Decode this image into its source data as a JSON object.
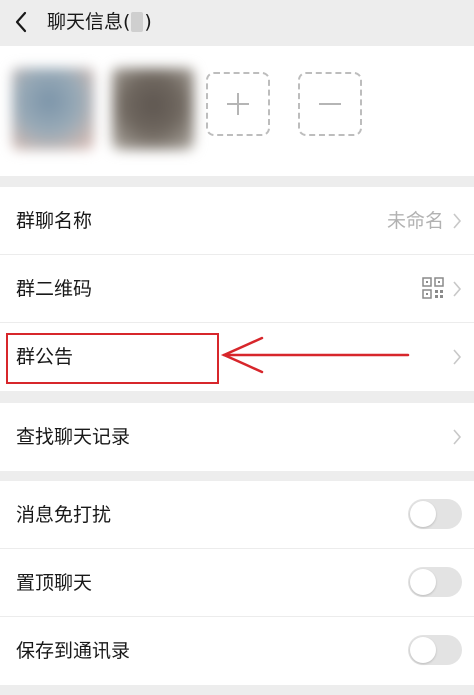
{
  "header": {
    "back_icon": "chevron-left-icon",
    "title": "聊天信息(",
    "title_suffix": ")"
  },
  "members": {
    "add_icon": "plus-icon",
    "remove_icon": "minus-icon"
  },
  "settings": {
    "group_name": {
      "label": "群聊名称",
      "value": "未命名"
    },
    "qr_code": {
      "label": "群二维码",
      "icon": "qr-code-icon"
    },
    "announcement": {
      "label": "群公告"
    },
    "search_history": {
      "label": "查找聊天记录"
    },
    "mute": {
      "label": "消息免打扰",
      "on": false
    },
    "pin": {
      "label": "置顶聊天",
      "on": false
    },
    "save_contacts": {
      "label": "保存到通讯录",
      "on": false
    }
  },
  "annotation": {
    "color": "#d7262b"
  }
}
